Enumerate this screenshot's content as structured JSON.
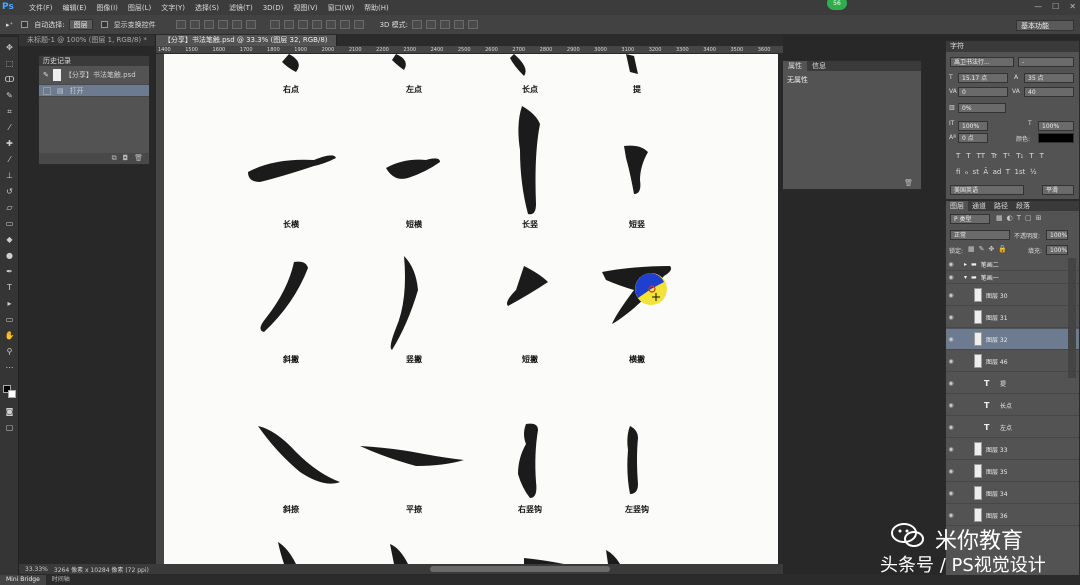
{
  "app": {
    "logo": "Ps",
    "notify_count": "56"
  },
  "menu": [
    "文件(F)",
    "编辑(E)",
    "图像(I)",
    "图层(L)",
    "文字(Y)",
    "选择(S)",
    "滤镜(T)",
    "3D(D)",
    "视图(V)",
    "窗口(W)",
    "帮助(H)"
  ],
  "options": {
    "auto_select_label": "自动选择:",
    "auto_select_value": "图层",
    "show_transform_label": "显示变换控件",
    "mode3d_label": "3D 模式:",
    "workspace": "基本功能"
  },
  "tabs": [
    "未标题-1 @ 100% (图层 1, RGB/8) *",
    "【分享】书法笔触.psd @ 33.3% (图层 32, RGB/8)"
  ],
  "ruler_top": [
    "1400",
    "1500",
    "1600",
    "1700",
    "1800",
    "1900",
    "2000",
    "2100",
    "2200",
    "2300",
    "2400",
    "2500",
    "2600",
    "2700",
    "2800",
    "2900",
    "3000",
    "3100",
    "3200",
    "3300",
    "3400",
    "3500",
    "3600"
  ],
  "history": {
    "title": "历史记录",
    "rows": [
      {
        "label": "【分享】书法笔触.psd"
      },
      {
        "label": "打开"
      }
    ]
  },
  "properties": {
    "tabs": [
      "属性",
      "信息"
    ],
    "body": "无属性"
  },
  "character": {
    "title": "字符",
    "font_family": "禹卫书法行...",
    "font_style": "-",
    "size": "15.17 点",
    "leading": "35 点",
    "kerning": "0",
    "tracking": "40",
    "vscale_pct": "0%",
    "vscale": "100%",
    "hscale": "100%",
    "baseline": "0 点",
    "color_label": "颜色:",
    "style_buttons": [
      "T",
      "T",
      "TT",
      "Tr",
      "T¹",
      "T₁",
      "T",
      "T"
    ],
    "lang": "美国英语",
    "aa": "平滑"
  },
  "layers_panel": {
    "tabs": [
      "图层",
      "通道",
      "路径",
      "段落"
    ],
    "filter": "P 类型",
    "blend": "正常",
    "opacity_label": "不透明度:",
    "opacity": "100%",
    "lock_label": "锁定:",
    "fill_label": "填充:",
    "fill": "100%",
    "rows": [
      {
        "kind": "group",
        "name": "笔画二"
      },
      {
        "kind": "group",
        "name": "笔画一"
      },
      {
        "kind": "layer",
        "name": "图层 30"
      },
      {
        "kind": "layer",
        "name": "图层 31"
      },
      {
        "kind": "layer",
        "name": "图层 32"
      },
      {
        "kind": "layer",
        "name": "图层 46"
      },
      {
        "kind": "text",
        "name": "提"
      },
      {
        "kind": "text",
        "name": "长点"
      },
      {
        "kind": "text",
        "name": "左点"
      },
      {
        "kind": "layer",
        "name": "图层 33"
      },
      {
        "kind": "layer",
        "name": "图层 35"
      },
      {
        "kind": "layer",
        "name": "图层 34"
      },
      {
        "kind": "layer",
        "name": "图层 36"
      }
    ]
  },
  "canvas_labels": [
    [
      "右点",
      "左点",
      "长点",
      "提"
    ],
    [
      "长横",
      "短横",
      "长竖",
      "短竖"
    ],
    [
      "斜撇",
      "竖撇",
      "短撇",
      "横撇"
    ],
    [
      "斜捺",
      "平捺",
      "右竖钩",
      "左竖钩"
    ]
  ],
  "status": {
    "zoom": "33.33%",
    "doc": "3264 像素 x 10284 像素 (72 ppi)"
  },
  "bottom_tabs": [
    "Mini Bridge",
    "时间轴"
  ],
  "watermark": {
    "line1": "米你教育",
    "line2": "头条号 / PS视觉设计"
  },
  "colors": {
    "accent_blue": "#1f3fd1",
    "accent_yellow": "#f3e23a",
    "selected_row": "#6c7b8f"
  }
}
